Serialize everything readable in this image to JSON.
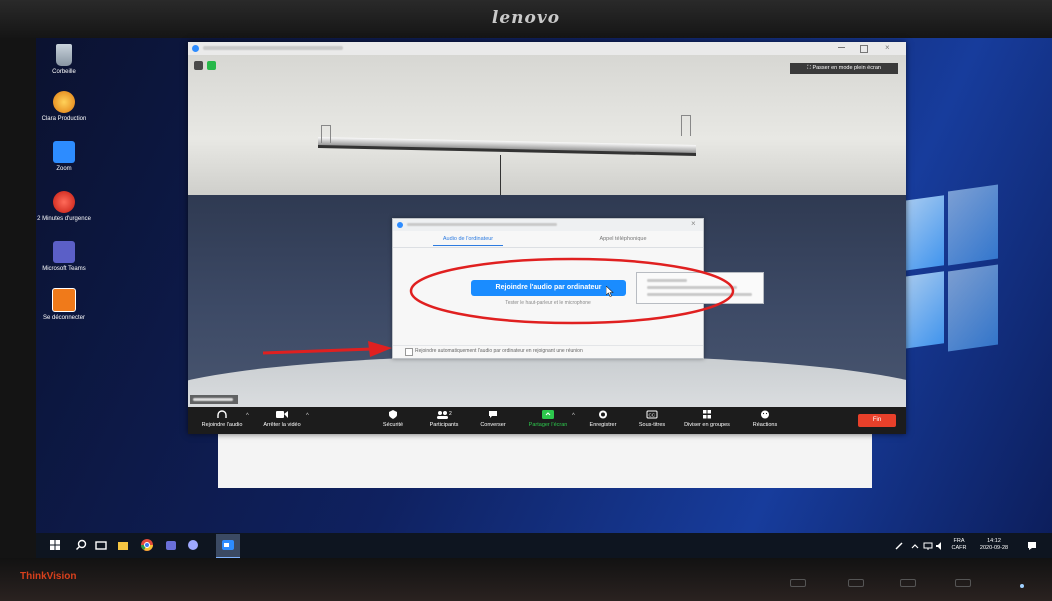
{
  "monitor": {
    "brand": "lenovo",
    "model": "ThinkVision"
  },
  "desktop_icons": [
    {
      "label": "Corbeille",
      "icon": "recycle-bin-icon"
    },
    {
      "label": "Clara Production",
      "icon": "app-orange-icon"
    },
    {
      "label": "Zoom",
      "icon": "zoom-icon"
    },
    {
      "label": "2 Minutes d'urgence",
      "icon": "alarm-icon"
    },
    {
      "label": "Microsoft Teams",
      "icon": "teams-icon"
    },
    {
      "label": "Se déconnecter",
      "icon": "power-icon"
    }
  ],
  "zoom": {
    "fullscreen_label": "Passer en mode plein écran",
    "toolbar": {
      "items": [
        {
          "label": "Rejoindre l'audio",
          "icon": "headphones-icon"
        },
        {
          "label": "Arrêter la vidéo",
          "icon": "video-camera-icon"
        },
        {
          "label": "Sécurité",
          "icon": "shield-icon"
        },
        {
          "label": "Participants",
          "icon": "participants-icon",
          "count": "2"
        },
        {
          "label": "Converser",
          "icon": "chat-icon"
        },
        {
          "label": "Partager l'écran",
          "icon": "share-screen-icon"
        },
        {
          "label": "Enregistrer",
          "icon": "record-icon"
        },
        {
          "label": "Sous-titres",
          "icon": "cc-icon"
        },
        {
          "label": "Diviser en groupes",
          "icon": "breakout-icon"
        },
        {
          "label": "Réactions",
          "icon": "reactions-icon"
        }
      ],
      "end_label": "Fin"
    },
    "audio_dialog": {
      "tabs": [
        "Audio de l'ordinateur",
        "Appel téléphonique"
      ],
      "join_button": "Rejoindre l'audio par ordinateur",
      "test_link": "Tester le haut-parleur et le microphone",
      "auto_join_label": "Rejoindre automatiquement l'audio par ordinateur en rejoignant une réunion",
      "auto_join_checked": false
    }
  },
  "taskbar": {
    "icons": [
      "start-icon",
      "search-icon",
      "task-view-icon",
      "file-explorer-icon",
      "chrome-icon",
      "teams-icon",
      "zoom-icon"
    ],
    "language": "FRA",
    "keyboard": "CAFR",
    "time": "14:12",
    "date": "2020-09-28"
  },
  "colors": {
    "accent": "#1a8cff",
    "share_green": "#2dc84d",
    "end_red": "#e8402a",
    "annotation_red": "#e02020"
  }
}
